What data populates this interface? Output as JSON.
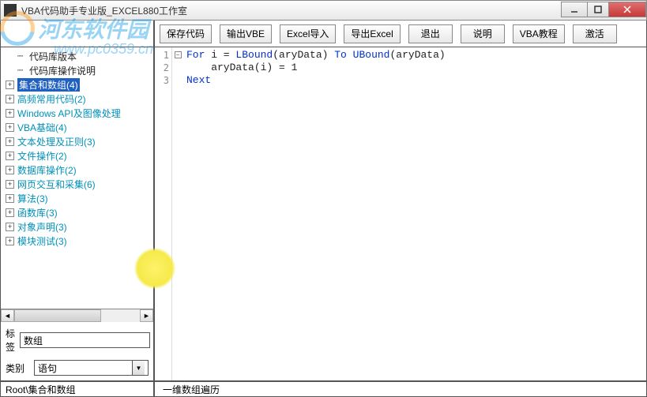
{
  "window": {
    "title": "VBA代码助手专业版_EXCEL880工作室"
  },
  "watermark": {
    "brand": "河东软件园",
    "url": "www.pc0359.cn"
  },
  "toolbar": {
    "save": "保存代码",
    "export_vbe": "输出VBE",
    "excel_import": "Excel导入",
    "excel_export": "导出Excel",
    "exit": "退出",
    "help": "说明",
    "tutorial": "VBA教程",
    "activate": "激活"
  },
  "tree": {
    "items": [
      {
        "kind": "top",
        "label": "代码库版本"
      },
      {
        "kind": "top",
        "label": "代码库操作说明"
      },
      {
        "kind": "cat",
        "label": "集合和数组(4)",
        "selected": true
      },
      {
        "kind": "cat",
        "label": "高频常用代码(2)"
      },
      {
        "kind": "cat",
        "label": "Windows API及图像处理"
      },
      {
        "kind": "cat",
        "label": "VBA基础(4)"
      },
      {
        "kind": "cat",
        "label": "文本处理及正则(3)"
      },
      {
        "kind": "cat",
        "label": "文件操作(2)"
      },
      {
        "kind": "cat",
        "label": "数据库操作(2)"
      },
      {
        "kind": "cat",
        "label": "网页交互和采集(6)"
      },
      {
        "kind": "cat",
        "label": "算法(3)"
      },
      {
        "kind": "cat",
        "label": "函数库(3)"
      },
      {
        "kind": "cat",
        "label": "对象声明(3)"
      },
      {
        "kind": "cat",
        "label": "模块测试(3)"
      }
    ]
  },
  "fields": {
    "tag_label": "标签",
    "tag_value": "数组",
    "cat_label": "类别",
    "cat_value": "语句"
  },
  "code": {
    "lines": [
      "1",
      "2",
      "3"
    ],
    "l1_kw1": "For",
    "l1_txt1": " i = ",
    "l1_kw2": "LBound",
    "l1_txt2": "(aryData) ",
    "l1_kw3": "To",
    "l1_txt3": " ",
    "l1_kw4": "UBound",
    "l1_txt4": "(aryData)",
    "l2": "    aryData(i) = 1",
    "l3_kw": "Next"
  },
  "status": {
    "path": "Root\\集合和数组",
    "desc": "一维数组遍历"
  }
}
